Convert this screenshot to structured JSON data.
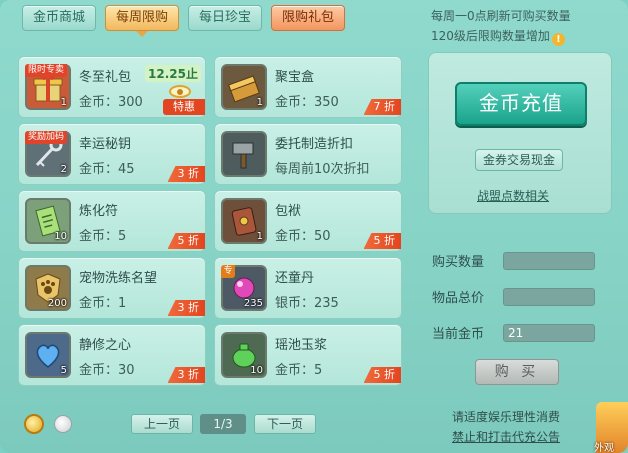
{
  "tabs": [
    {
      "label": "金币商城",
      "active": false
    },
    {
      "label": "每周限购",
      "active": true
    },
    {
      "label": "每日珍宝",
      "active": false
    },
    {
      "label": "限购礼包",
      "active": false
    }
  ],
  "notice": {
    "line1": "每周一0点刷新可购买数量",
    "line2": "120级后限购数量增加",
    "info_icon": "!"
  },
  "items": [
    {
      "name": "冬至礼包",
      "price": "金币：300",
      "count": "1",
      "ribbon": "限时专卖",
      "deadline": "12.25止",
      "badge": "特惠",
      "icon": "gift-box-icon"
    },
    {
      "name": "聚宝盒",
      "price": "金币：350",
      "count": "1",
      "badge": "7 折",
      "icon": "treasure-box-icon"
    },
    {
      "name": "幸运秘钥",
      "price": "金币：45",
      "count": "2",
      "ribbon": "奖励加码",
      "badge": "3 折",
      "icon": "key-icon"
    },
    {
      "name": "委托制造折扣",
      "price": "每周前10次折扣",
      "count": "",
      "icon": "hammer-icon"
    },
    {
      "name": "炼化符",
      "price": "金币：5",
      "count": "10",
      "badge": "5 折",
      "icon": "talisman-icon"
    },
    {
      "name": "包袱",
      "price": "金币：50",
      "count": "1",
      "badge": "5 折",
      "icon": "bag-icon"
    },
    {
      "name": "宠物洗练名望",
      "price": "金币：1",
      "count": "200",
      "badge": "3 折",
      "icon": "paw-badge-icon"
    },
    {
      "name": "还童丹",
      "price": "银币：235",
      "count": "235",
      "ribbon": "专",
      "badge": "",
      "icon": "pill-icon"
    },
    {
      "name": "静修之心",
      "price": "金币：30",
      "count": "5",
      "badge": "3 折",
      "icon": "heart-gem-icon"
    },
    {
      "name": "瑶池玉浆",
      "price": "金币：5",
      "count": "10",
      "badge": "5 折",
      "icon": "jade-pot-icon"
    }
  ],
  "panel": {
    "recharge": "金币充值",
    "ticket": "金券交易现金",
    "alliance": "战盟点数相关"
  },
  "form": {
    "qty_label": "购买数量",
    "total_label": "物品总价",
    "gold_label": "当前金币",
    "qty_value": "",
    "total_value": "",
    "gold_value": "21",
    "buy": "购 买"
  },
  "pager": {
    "prev": "上一页",
    "page": "1/3",
    "next": "下一页"
  },
  "footer": {
    "line1": "请适度娱乐理性消费",
    "line2": "禁止和打击代充公告"
  },
  "corner": {
    "label": "外观"
  }
}
